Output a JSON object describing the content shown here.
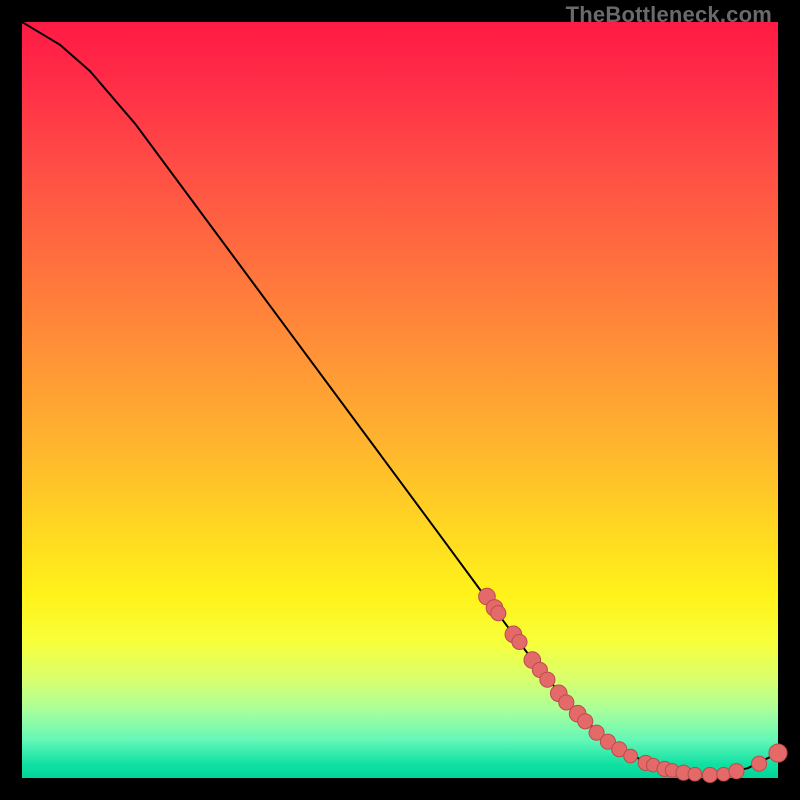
{
  "watermark": "TheBottleneck.com",
  "colors": {
    "gradient_top": "#ff1a45",
    "gradient_mid": "#ffe61a",
    "gradient_bottom": "#00d49a",
    "curve": "#000000",
    "marker_fill": "#e46a6a",
    "marker_stroke": "#bc4a4a"
  },
  "chart_data": {
    "type": "line",
    "title": "",
    "xlabel": "",
    "ylabel": "",
    "xlim": [
      0,
      100
    ],
    "ylim": [
      0,
      100
    ],
    "curve": [
      {
        "x": 0,
        "y": 100
      },
      {
        "x": 2,
        "y": 98.8
      },
      {
        "x": 5,
        "y": 97.0
      },
      {
        "x": 9,
        "y": 93.5
      },
      {
        "x": 15,
        "y": 86.5
      },
      {
        "x": 25,
        "y": 73.0
      },
      {
        "x": 35,
        "y": 59.5
      },
      {
        "x": 45,
        "y": 46.0
      },
      {
        "x": 55,
        "y": 32.5
      },
      {
        "x": 62,
        "y": 23.0
      },
      {
        "x": 68,
        "y": 15.0
      },
      {
        "x": 73,
        "y": 9.0
      },
      {
        "x": 78,
        "y": 4.5
      },
      {
        "x": 83,
        "y": 1.8
      },
      {
        "x": 88,
        "y": 0.6
      },
      {
        "x": 92,
        "y": 0.4
      },
      {
        "x": 96,
        "y": 1.3
      },
      {
        "x": 100,
        "y": 3.3
      }
    ],
    "markers": [
      {
        "x": 61.5,
        "y": 24.0,
        "r": 1.1
      },
      {
        "x": 62.5,
        "y": 22.5,
        "r": 1.1
      },
      {
        "x": 63.0,
        "y": 21.8,
        "r": 1.0
      },
      {
        "x": 65.0,
        "y": 19.0,
        "r": 1.1
      },
      {
        "x": 65.8,
        "y": 18.0,
        "r": 1.0
      },
      {
        "x": 67.5,
        "y": 15.6,
        "r": 1.1
      },
      {
        "x": 68.5,
        "y": 14.3,
        "r": 1.0
      },
      {
        "x": 69.5,
        "y": 13.0,
        "r": 1.0
      },
      {
        "x": 71.0,
        "y": 11.2,
        "r": 1.1
      },
      {
        "x": 72.0,
        "y": 10.0,
        "r": 1.0
      },
      {
        "x": 73.5,
        "y": 8.5,
        "r": 1.1
      },
      {
        "x": 74.5,
        "y": 7.5,
        "r": 1.0
      },
      {
        "x": 76.0,
        "y": 6.0,
        "r": 1.0
      },
      {
        "x": 77.5,
        "y": 4.8,
        "r": 1.0
      },
      {
        "x": 79.0,
        "y": 3.8,
        "r": 1.0
      },
      {
        "x": 80.5,
        "y": 2.9,
        "r": 0.9
      },
      {
        "x": 82.5,
        "y": 2.0,
        "r": 1.0
      },
      {
        "x": 83.5,
        "y": 1.7,
        "r": 0.9
      },
      {
        "x": 85.0,
        "y": 1.2,
        "r": 1.0
      },
      {
        "x": 86.0,
        "y": 1.0,
        "r": 0.9
      },
      {
        "x": 87.5,
        "y": 0.7,
        "r": 1.0
      },
      {
        "x": 89.0,
        "y": 0.5,
        "r": 0.9
      },
      {
        "x": 91.0,
        "y": 0.4,
        "r": 1.0
      },
      {
        "x": 92.8,
        "y": 0.5,
        "r": 0.9
      },
      {
        "x": 94.5,
        "y": 0.9,
        "r": 1.0
      },
      {
        "x": 97.5,
        "y": 1.9,
        "r": 1.0
      },
      {
        "x": 100,
        "y": 3.3,
        "r": 1.2
      }
    ]
  }
}
